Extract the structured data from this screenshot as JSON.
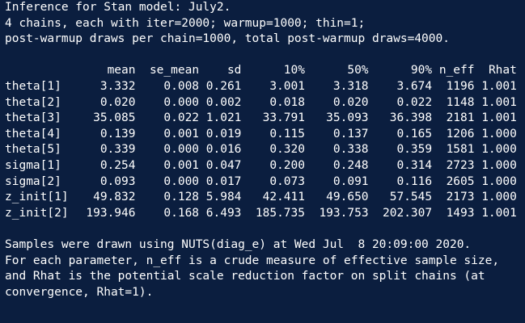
{
  "header": {
    "line1": "Inference for Stan model: July2.",
    "line2": "4 chains, each with iter=2000; warmup=1000; thin=1;",
    "line3": "post-warmup draws per chain=1000, total post-warmup draws=4000."
  },
  "table": {
    "columns": [
      "mean",
      "se_mean",
      "sd",
      "10%",
      "50%",
      "90%",
      "n_eff",
      "Rhat"
    ],
    "rows": [
      {
        "name": "theta[1]",
        "mean": "3.332",
        "se_mean": "0.008",
        "sd": "0.261",
        "p10": "3.001",
        "p50": "3.318",
        "p90": "3.674",
        "n_eff": "1196",
        "rhat": "1.001"
      },
      {
        "name": "theta[2]",
        "mean": "0.020",
        "se_mean": "0.000",
        "sd": "0.002",
        "p10": "0.018",
        "p50": "0.020",
        "p90": "0.022",
        "n_eff": "1148",
        "rhat": "1.001"
      },
      {
        "name": "theta[3]",
        "mean": "35.085",
        "se_mean": "0.022",
        "sd": "1.021",
        "p10": "33.791",
        "p50": "35.093",
        "p90": "36.398",
        "n_eff": "2181",
        "rhat": "1.001"
      },
      {
        "name": "theta[4]",
        "mean": "0.139",
        "se_mean": "0.001",
        "sd": "0.019",
        "p10": "0.115",
        "p50": "0.137",
        "p90": "0.165",
        "n_eff": "1206",
        "rhat": "1.000"
      },
      {
        "name": "theta[5]",
        "mean": "0.339",
        "se_mean": "0.000",
        "sd": "0.016",
        "p10": "0.320",
        "p50": "0.338",
        "p90": "0.359",
        "n_eff": "1581",
        "rhat": "1.000"
      },
      {
        "name": "sigma[1]",
        "mean": "0.254",
        "se_mean": "0.001",
        "sd": "0.047",
        "p10": "0.200",
        "p50": "0.248",
        "p90": "0.314",
        "n_eff": "2723",
        "rhat": "1.000"
      },
      {
        "name": "sigma[2]",
        "mean": "0.093",
        "se_mean": "0.000",
        "sd": "0.017",
        "p10": "0.073",
        "p50": "0.091",
        "p90": "0.116",
        "n_eff": "2605",
        "rhat": "1.000"
      },
      {
        "name": "z_init[1]",
        "mean": "49.832",
        "se_mean": "0.128",
        "sd": "5.984",
        "p10": "42.411",
        "p50": "49.650",
        "p90": "57.545",
        "n_eff": "2173",
        "rhat": "1.000"
      },
      {
        "name": "z_init[2]",
        "mean": "193.946",
        "se_mean": "0.168",
        "sd": "6.493",
        "p10": "185.735",
        "p50": "193.753",
        "p90": "202.307",
        "n_eff": "1493",
        "rhat": "1.001"
      }
    ]
  },
  "footer": {
    "line1": "Samples were drawn using NUTS(diag_e) at Wed Jul  8 20:09:00 2020.",
    "line2": "For each parameter, n_eff is a crude measure of effective sample size,",
    "line3": "and Rhat is the potential scale reduction factor on split chains (at",
    "line4": "convergence, Rhat=1)."
  },
  "colors": {
    "background": "#0b1e3f",
    "text": "#ffffff"
  }
}
